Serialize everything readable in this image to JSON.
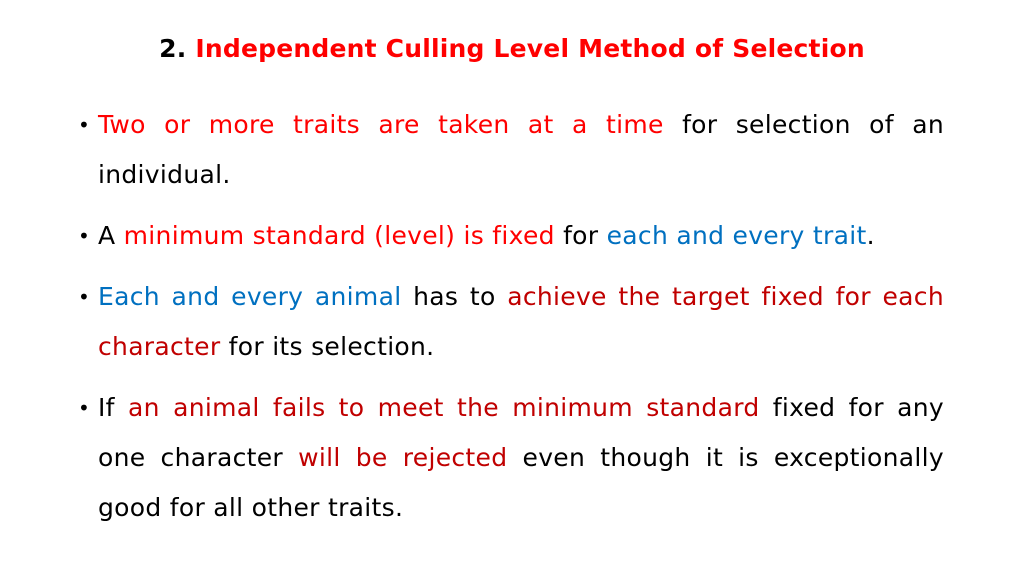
{
  "slide": {
    "title": {
      "number": "2.",
      "text": "Independent Culling Level Method of Selection"
    },
    "colors": {
      "red": "#ff0000",
      "dark_red": "#c00000",
      "blue": "#0070c0",
      "black": "#000000"
    },
    "bullets": [
      {
        "segments": [
          {
            "text": "Two or more traits are taken at a time",
            "color": "red"
          },
          {
            "text": " for selection of an individual.",
            "color": "black"
          }
        ]
      },
      {
        "segments": [
          {
            "text": "A ",
            "color": "black"
          },
          {
            "text": "minimum standard (level) is fixed",
            "color": "red"
          },
          {
            "text": " for ",
            "color": "black"
          },
          {
            "text": "each and every trait",
            "color": "blue"
          },
          {
            "text": ".",
            "color": "black"
          }
        ]
      },
      {
        "segments": [
          {
            "text": "Each and every animal",
            "color": "blue"
          },
          {
            "text": " has to ",
            "color": "black"
          },
          {
            "text": "achieve the target fixed for each character",
            "color": "dred"
          },
          {
            "text": " for its selection.",
            "color": "black"
          }
        ]
      },
      {
        "segments": [
          {
            "text": "If ",
            "color": "black"
          },
          {
            "text": "an animal fails to meet the minimum standard",
            "color": "dred"
          },
          {
            "text": " fixed for any one character ",
            "color": "black"
          },
          {
            "text": "will be rejected",
            "color": "dred"
          },
          {
            "text": " even though it is exceptionally good for all other traits.",
            "color": "black"
          }
        ]
      }
    ]
  }
}
